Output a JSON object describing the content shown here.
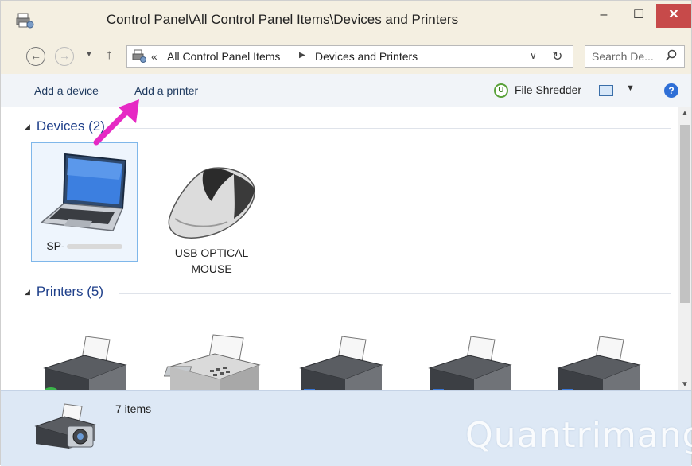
{
  "window": {
    "title": "Control Panel\\All Control Panel Items\\Devices and Printers",
    "controls": {
      "minimize": "–",
      "maximize": "☐",
      "close": "✕"
    }
  },
  "nav": {
    "back": "←",
    "forward": "→",
    "up": "↑",
    "address_prefix": "«",
    "breadcrumb": [
      "All Control Panel Items",
      "Devices and Printers"
    ],
    "search_placeholder": "Search De..."
  },
  "commands": {
    "add_device": "Add a device",
    "add_printer": "Add a printer",
    "file_shredder": "File Shredder"
  },
  "groups": {
    "devices": {
      "title": "Devices (2)",
      "items": [
        {
          "label": "SP-",
          "icon": "laptop-icon",
          "selected": true
        },
        {
          "label": "USB OPTICAL MOUSE",
          "icon": "mouse-icon",
          "selected": false
        }
      ]
    },
    "printers": {
      "title": "Printers (5)",
      "items": [
        {
          "icon": "printer-icon"
        },
        {
          "icon": "fax-icon"
        },
        {
          "icon": "printer-icon"
        },
        {
          "icon": "printer-icon"
        },
        {
          "icon": "printer-icon"
        }
      ]
    }
  },
  "details": {
    "count": "7 items"
  },
  "watermark": "Quantrimang",
  "colors": {
    "accent": "#1e3f8a",
    "close_button": "#c74a4a",
    "annotation_arrow": "#e629c4"
  }
}
